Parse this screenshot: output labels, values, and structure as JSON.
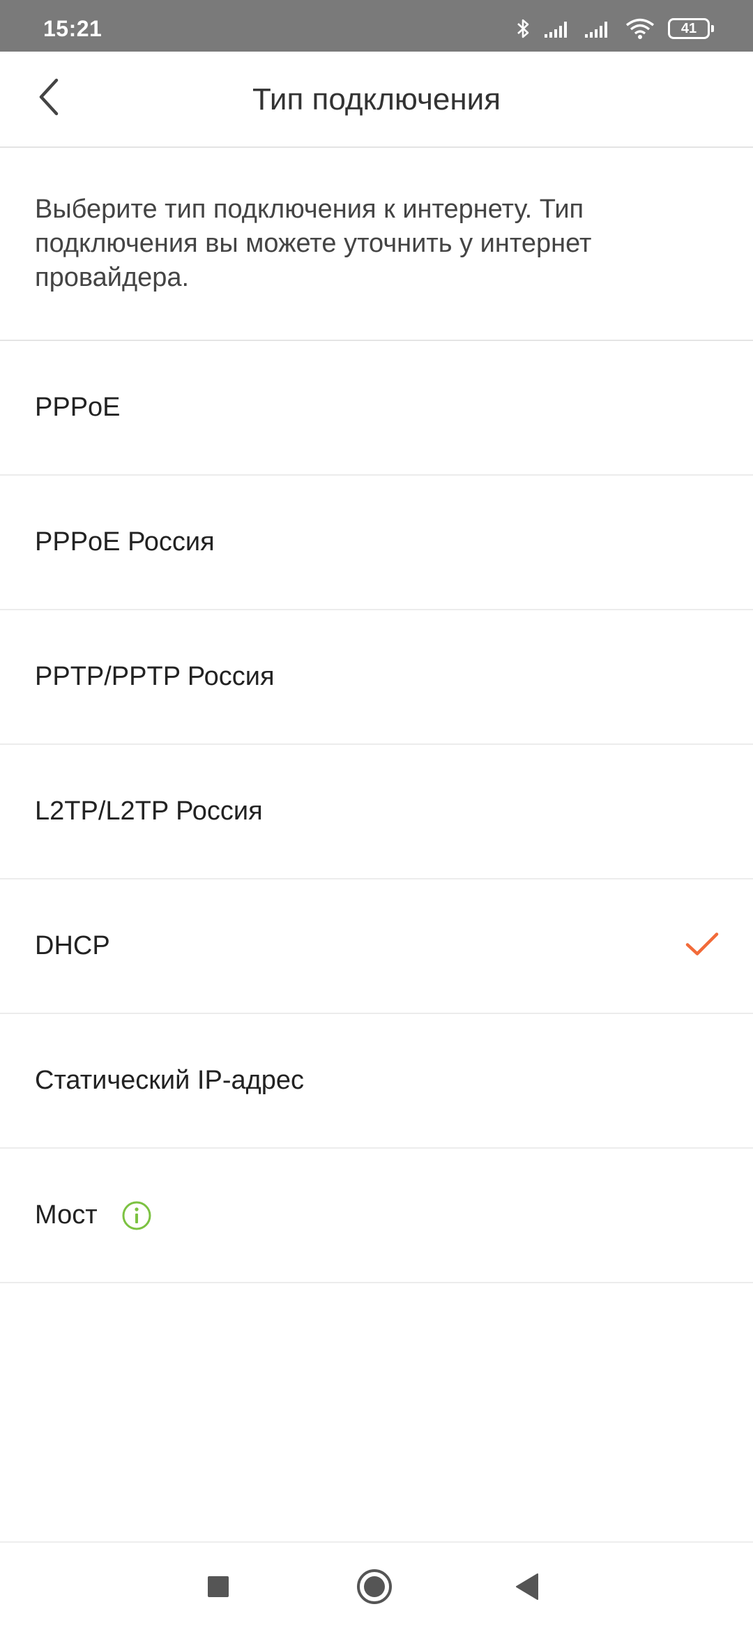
{
  "status_bar": {
    "time": "15:21",
    "battery": "41",
    "icons": [
      "bluetooth-icon",
      "signal-icon",
      "signal-icon",
      "wifi-icon",
      "battery-icon"
    ]
  },
  "header": {
    "title": "Тип подключения",
    "back_icon": "chevron-left-icon"
  },
  "description": "Выберите тип подключения к интернету. Тип подключения вы можете уточнить у интернет провайдера.",
  "options": [
    {
      "label": "PPPoE"
    },
    {
      "label": "PPPoE Россия"
    },
    {
      "label": "PPTP/PPTP Россия"
    },
    {
      "label": "L2TP/L2TP Россия"
    },
    {
      "label": "DHCP",
      "selected": true
    },
    {
      "label": "Статический IP-адрес"
    },
    {
      "label": "Мост",
      "info_icon": "info-icon"
    }
  ],
  "colors": {
    "accent_check": "#f26b3a",
    "info_green": "#7cc242",
    "status_bar": "#7a7a7a"
  },
  "nav_bar": {
    "icons": [
      "recents-square-icon",
      "home-circle-icon",
      "back-triangle-icon"
    ]
  }
}
